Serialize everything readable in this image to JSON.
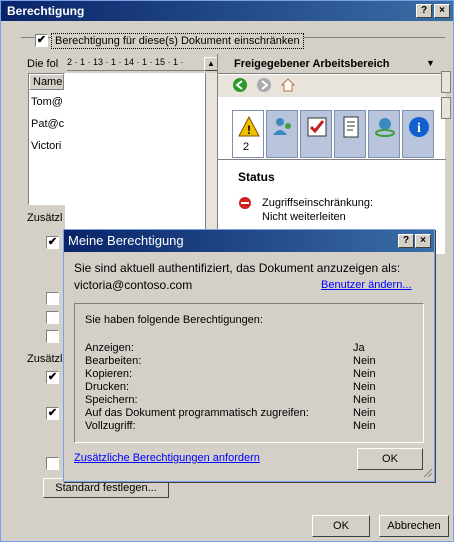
{
  "main": {
    "title": "Berechtigung",
    "help_btn": "?",
    "close_btn": "×",
    "restrict_label": "Berechtigung für diese(s) Dokument einschränken",
    "restrict_checked": true,
    "users_intro": "Die fol",
    "name_header": "Name",
    "users": [
      "Tom@",
      "Pat@c",
      "Victori"
    ],
    "addl1": "Zusätzl",
    "addl2": "Zusätzl",
    "standard_btn": "Standard festlegen...",
    "ok": "OK",
    "cancel": "Abbrechen",
    "left_checks": [
      true,
      false,
      false,
      false,
      true,
      true,
      false
    ]
  },
  "ruler": "2 · 1 · 13 · 1 · 14 · 1 · 15 · 1 ·",
  "taskpane": {
    "title": "Freigegebener Arbeitsbereich",
    "alert_count": "2",
    "status_heading": "Status",
    "status_line1": "Zugriffseinschränkung:",
    "status_line2": "Nicht weiterleiten"
  },
  "sub": {
    "title": "Meine Berechtigung",
    "help_btn": "?",
    "close_btn": "×",
    "auth_text": "Sie sind aktuell authentifiziert, das Dokument anzuzeigen als:",
    "email": "victoria@contoso.com",
    "change_user": "Benutzer ändern...",
    "perm_heading": "Sie haben folgende Berechtigungen:",
    "permissions": [
      {
        "label": "Anzeigen:",
        "value": "Ja"
      },
      {
        "label": "Bearbeiten:",
        "value": "Nein"
      },
      {
        "label": "Kopieren:",
        "value": "Nein"
      },
      {
        "label": "Drucken:",
        "value": "Nein"
      },
      {
        "label": "Speichern:",
        "value": "Nein"
      },
      {
        "label": "Auf das Dokument programmatisch zugreifen:",
        "value": "Nein"
      },
      {
        "label": "Vollzugriff:",
        "value": "Nein"
      }
    ],
    "request_link": "Zusätzliche Berechtigungen anfordern",
    "ok": "OK"
  }
}
